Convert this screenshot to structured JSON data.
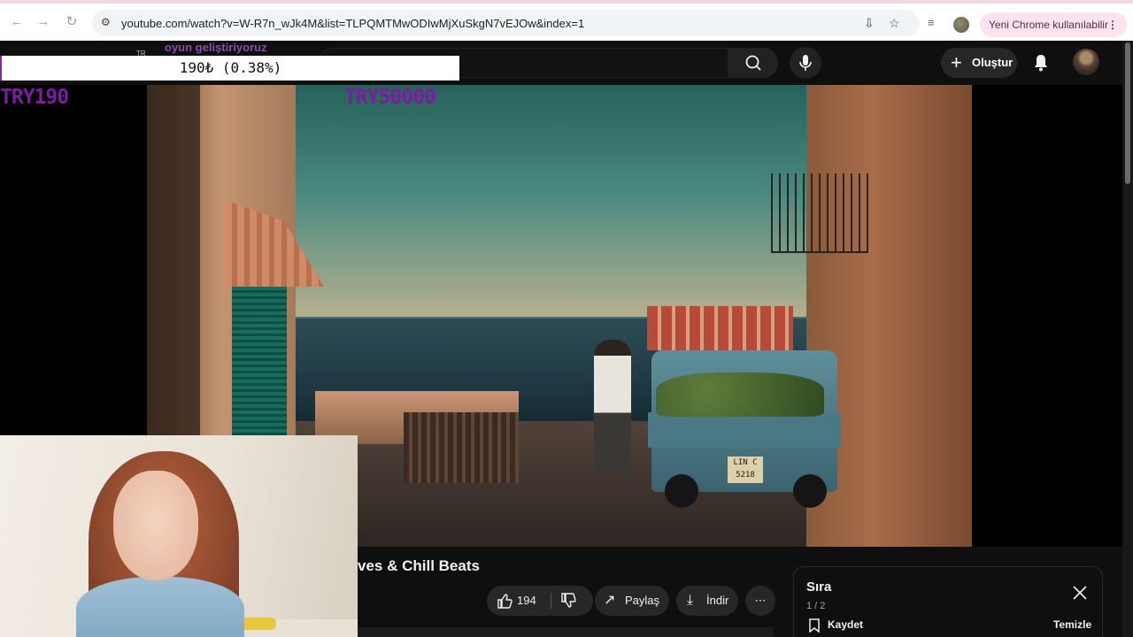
{
  "browser": {
    "url": "youtube.com/watch?v=W-R7n_wJk4M&list=TLPQMTMwODIwMjXuSkgN7vEJOw&index=1",
    "update_label": "Yeni Chrome kullanılabilir",
    "menu_glyph": "⋮"
  },
  "youtube_header": {
    "create_label": "Oluştur",
    "plus_glyph": "+"
  },
  "stream_overlay": {
    "caption": "oyun geliştiriyoruz",
    "donation_text": "190₺ (0.38%)",
    "current_amount": "TRY190",
    "goal_amount": "TRY50000",
    "tr_badge": "TR",
    "goal_progress_fraction": 0.0038
  },
  "video": {
    "plate_line1": "LIN C",
    "plate_line2": "5218",
    "title_visible": "ves & Chill Beats"
  },
  "actions": {
    "like_count": "194",
    "share_label": "Paylaş",
    "download_label": "İndir",
    "more_glyph": "⋯"
  },
  "queue": {
    "title": "Sıra",
    "count": "1 / 2",
    "save_label": "Kaydet",
    "clear_label": "Temizle"
  },
  "colors": {
    "accent_overlay": "#7a1d9e",
    "update_pill": "#fbe3ef",
    "yt_dark": "#0f0f0f"
  }
}
